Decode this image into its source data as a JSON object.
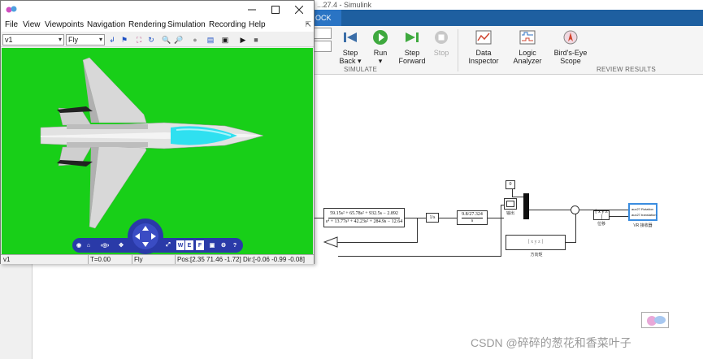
{
  "simulink": {
    "title_partial": "...27.4 - Simulink",
    "active_tab": "OCK",
    "buttons": [
      {
        "id": "step_back",
        "label_line1": "Step",
        "label_line2": "Back",
        "caret": "▾"
      },
      {
        "id": "run",
        "label_line1": "Run",
        "label_line2": "▾"
      },
      {
        "id": "step_forward",
        "label_line1": "Step",
        "label_line2": "Forward"
      },
      {
        "id": "stop",
        "label_line1": "Stop",
        "label_line2": ""
      },
      {
        "id": "data_inspector",
        "label_line1": "Data",
        "label_line2": "Inspector"
      },
      {
        "id": "logic_analyzer",
        "label_line1": "Logic",
        "label_line2": "Analyzer"
      },
      {
        "id": "birds_eye",
        "label_line1": "Bird's-Eye",
        "label_line2": "Scope"
      }
    ],
    "sections": {
      "simulate": "SIMULATE",
      "review": "REVIEW RESULTS"
    },
    "diagram": {
      "tf_numerator": "59.15s² + 65.78s² + 932.5s − 2.892",
      "tf_denominator": "s⁴ + 13.77s³ + 42.23s² + 284.9s − 12.64",
      "integrator": "1/s",
      "gain_block": "9.8/27.324",
      "gain_block_sub": "s",
      "const_block": "0",
      "vector_block": "[ x y z ]",
      "vector_block2": "[ x y z ]",
      "label_scope": "输出",
      "label_vec": "位移",
      "label_vec2": "方向矩",
      "label_vr": "VR 接收器",
      "vr_line1": "aux27.Rotation",
      "vr_line2": "aux27.translation"
    },
    "watermark": "CSDN @碎碎的葱花和香菜叶子"
  },
  "viewer": {
    "menus": [
      "File",
      "View",
      "Viewpoints",
      "Navigation",
      "Rendering",
      "Simulation",
      "Recording",
      "Help"
    ],
    "viewpoint": "v1",
    "nav_mode": "Fly",
    "status": {
      "viewpoint": "v1",
      "time": "T=0.00",
      "mode": "Fly",
      "pos": "Pos:[2.35 71.46 -1.72] Dir:[-0.06 -0.99 -0.08]"
    },
    "nav_buttons": [
      "W",
      "E",
      "F"
    ],
    "colors": {
      "scene_bg": "#18cf18",
      "nav_blue": "#2a3aa8",
      "canopy": "#2fe0f0"
    }
  }
}
